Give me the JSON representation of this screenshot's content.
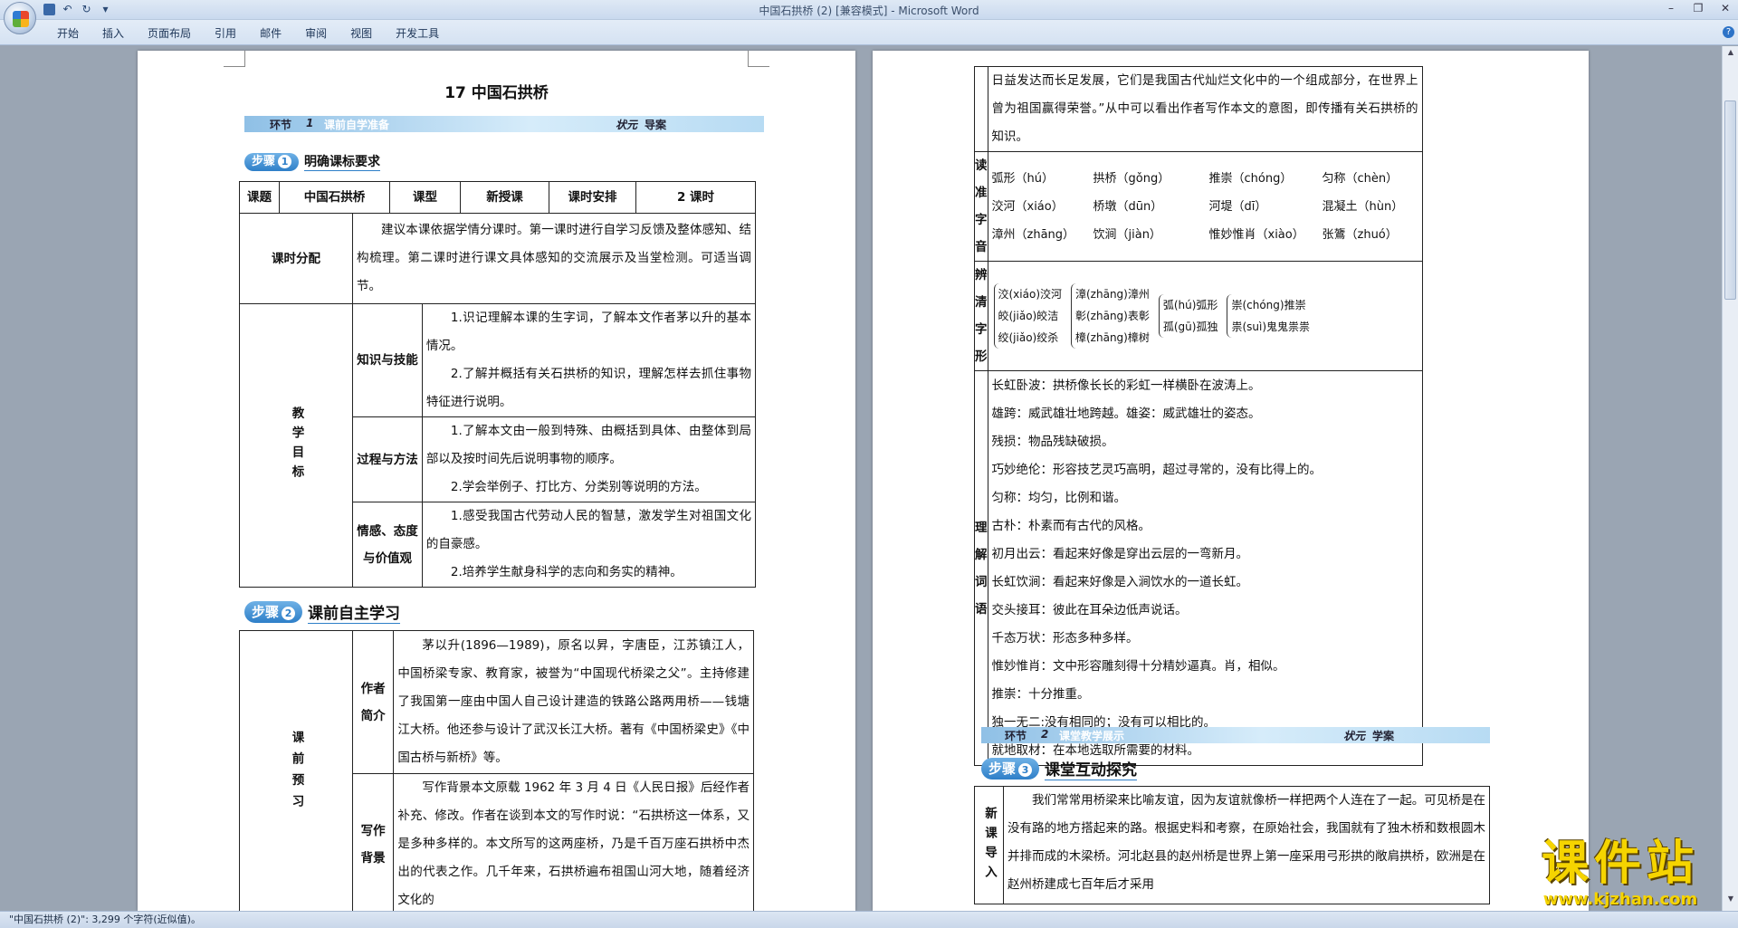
{
  "window": {
    "title": "中国石拱桥 (2) [兼容模式] - Microsoft Word"
  },
  "ribbon": {
    "tabs": [
      "开始",
      "插入",
      "页面布局",
      "引用",
      "邮件",
      "审阅",
      "视图",
      "开发工具"
    ]
  },
  "doc_left": {
    "title": "17  中国石拱桥",
    "band1": {
      "link": "环节",
      "num": "1",
      "name": "课前自学准备",
      "brand_a": "状元",
      "brand_b": "导案"
    },
    "step1": {
      "label": "步骤",
      "num": "1",
      "title": "明确课标要求"
    },
    "table1": {
      "header": [
        "课题",
        "中国石拱桥",
        "课型",
        "新授课",
        "课时安排",
        "2 课时"
      ],
      "fenpei_label": "课时分配",
      "fenpei_text": "建议本课依据学情分课时。第一课时进行自学习反馈及整体感知、结构梳理。第二课时进行课文具体感知的交流展示及当堂检测。可适当调节。",
      "goal_label": "教学目标",
      "goals": [
        {
          "label": "知识与技能",
          "items": [
            "1.识记理解本课的生字词，了解本文作者茅以升的基本情况。",
            "2.了解并概括有关石拱桥的知识，理解怎样去抓住事物特征进行说明。"
          ]
        },
        {
          "label": "过程与方法",
          "items": [
            "1.了解本文由一般到特殊、由概括到具体、由整体到局部以及按时间先后说明事物的顺序。",
            "2.学会举例子、打比方、分类别等说明的方法。"
          ]
        },
        {
          "label": "情感、态度与价值观",
          "items": [
            "1.感受我国古代劳动人民的智慧，激发学生对祖国文化的自豪感。",
            "2.培养学生献身科学的志向和务实的精神。"
          ]
        }
      ]
    },
    "step2": {
      "label": "步骤",
      "num": "2",
      "title": "课前自主学习"
    },
    "table2": {
      "main_label": "课前预习",
      "author_label": "作者简介",
      "author_text": "茅以升(1896—1989)，原名以昇，字唐臣，江苏镇江人，中国桥梁专家、教育家，被誉为“中国现代桥梁之父”。主持修建了我国第一座由中国人自己设计建造的铁路公路两用桥——钱塘江大桥。他还参与设计了武汉长江大桥。著有《中国桥梁史》《中国古桥与新桥》等。",
      "bg_label": "写作背景",
      "bg_text": "写作背景本文原载 1962 年 3 月 4 日《人民日报》后经作者补充、修改。作者在谈到本文的写作时说：“石拱桥这一体系，又是多种多样的。本文所写的这两座桥，乃是千百万座石拱桥中杰出的代表之作。几千年来，石拱桥遍布祖国山河大地，随着经济文化的"
    }
  },
  "doc_right": {
    "cont_text": "日益发达而长足发展，它们是我国古代灿烂文化中的一个组成部分，在世界上曾为祖国赢得荣誉。”从中可以看出作者写作本文的意图，即传播有关石拱桥的知识。",
    "duzhun_label": "读准字音",
    "pinyin": [
      "弧形（hú）",
      "拱桥（gǒng）",
      "推崇（chóng）",
      "匀称（chèn）",
      "洨河（xiáo）",
      "桥墩（dūn）",
      "河堤（dī）",
      "混凝土（hùn）",
      "漳州（zhāng）",
      "饮涧（jiàn）",
      "惟妙惟肖（xiào）",
      "张鷟（zhuó）"
    ],
    "bianqing_label": "辨清字形",
    "bian": [
      [
        "洨(xiáo)洨河",
        "皎(jiǎo)皎洁",
        "绞(jiǎo)绞杀"
      ],
      [
        "漳(zhāng)漳州",
        "彰(zhāng)表彰",
        "樟(zhāng)樟树"
      ],
      [
        "弧(hú)弧形",
        "孤(gū)孤独"
      ],
      [
        "崇(chóng)推崇",
        "祟(suì)鬼鬼祟祟"
      ]
    ],
    "lijie_label": "理解词语",
    "vocab": [
      "长虹卧波：拱桥像长长的彩虹一样横卧在波涛上。",
      "雄跨：威武雄壮地跨越。雄姿：威武雄壮的姿态。",
      "残损：物品残缺破损。",
      "巧妙绝伦：形容技艺灵巧高明，超过寻常的，没有比得上的。",
      "匀称：均匀，比例和谐。",
      "古朴：朴素而有古代的风格。",
      "初月出云：看起来好像是穿出云层的一弯新月。",
      "长虹饮涧：看起来好像是入涧饮水的一道长虹。",
      "交头接耳：彼此在耳朵边低声说话。",
      "千态万状：形态多种多样。",
      "惟妙惟肖：文中形容雕刻得十分精妙逼真。肖，相似。",
      "推崇：十分推重。",
      "独一无二:没有相同的；没有可以相比的。",
      "就地取材：在本地选取所需要的材料。"
    ],
    "band2": {
      "link": "环节",
      "num": "2",
      "name": "课堂教学展示",
      "brand_a": "状元",
      "brand_b": "学案"
    },
    "step3": {
      "label": "步骤",
      "num": "3",
      "title": "课堂互动探究"
    },
    "xinke_label": "新课导入",
    "xinke_text": "我们常常用桥梁来比喻友谊，因为友谊就像桥一样把两个人连在了一起。可见桥是在没有路的地方搭起来的路。根据史料和考察，在原始社会，我国就有了独木桥和数根圆木并排而成的木梁桥。河北赵县的赵州桥是世界上第一座采用弓形拱的敞肩拱桥，欧洲是在赵州桥建成七百年后才采用"
  },
  "status": {
    "text": "\"中国石拱桥 (2)\": 3,299 个字符(近似值)。"
  },
  "watermark": {
    "big": "课件站",
    "small": "www.kjzhan.com"
  }
}
